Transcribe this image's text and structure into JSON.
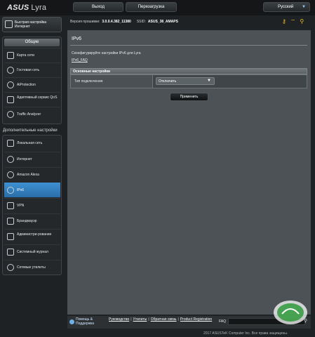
{
  "header": {
    "brand": "ASUS",
    "product": "Lyra",
    "logout_label": "Выход",
    "reboot_label": "Перезагрузка",
    "language": "Русский"
  },
  "firmware": {
    "label": "Версия прошивки:",
    "version": "3.0.0.4.382_11380",
    "ssid_label": "SSID:",
    "ssid": "ASUS_38_AMAPS"
  },
  "sidebar": {
    "qis_label": "Быстрая настройка Интернет",
    "general_title": "Общие",
    "general_items": [
      {
        "label": "Карта сети",
        "icon": "network-map-icon"
      },
      {
        "label": "Гостевая сеть",
        "icon": "guest-network-icon"
      },
      {
        "label": "AiProtection",
        "icon": "aiprotection-icon"
      },
      {
        "label": "Адаптивный сервис QoS",
        "icon": "qos-icon"
      },
      {
        "label": "Traffic Analyzer",
        "icon": "traffic-analyzer-icon"
      }
    ],
    "advanced_title": "Дополнительные настройки",
    "advanced_items": [
      {
        "label": "Локальная сеть",
        "icon": "lan-icon"
      },
      {
        "label": "Интернет",
        "icon": "globe-icon"
      },
      {
        "label": "Amazon Alexa",
        "icon": "alexa-icon"
      },
      {
        "label": "IPv6",
        "icon": "ipv6-icon"
      },
      {
        "label": "VPN",
        "icon": "vpn-icon"
      },
      {
        "label": "Брандмауэр",
        "icon": "firewall-icon"
      },
      {
        "label": "Администри-рование",
        "icon": "administration-icon"
      },
      {
        "label": "Системный журнал",
        "icon": "system-log-icon"
      },
      {
        "label": "Сетевые утилиты",
        "icon": "network-tools-icon"
      }
    ]
  },
  "main": {
    "title": "IPv6",
    "description": "Сконфигурируйте настройки IPv6 для Lyra",
    "faq_link": "IPv6_FAQ",
    "section_title": "Основные настройки",
    "connection_type_label": "Тип подключения",
    "connection_type_value": "Отключить",
    "apply_label": "Применить"
  },
  "footer": {
    "help_label": "Помощь & Поддержка",
    "links": [
      "Руководство",
      "Утилиты",
      "Обратная связь",
      "Product Registration"
    ],
    "faq_label": "FAQ",
    "copyright": "2017 ASUSTeK Computer Inc. Все права защищены."
  },
  "colors": {
    "accent": "#2f7fc1",
    "background": "#1f2224",
    "panel": "#4c5256"
  }
}
